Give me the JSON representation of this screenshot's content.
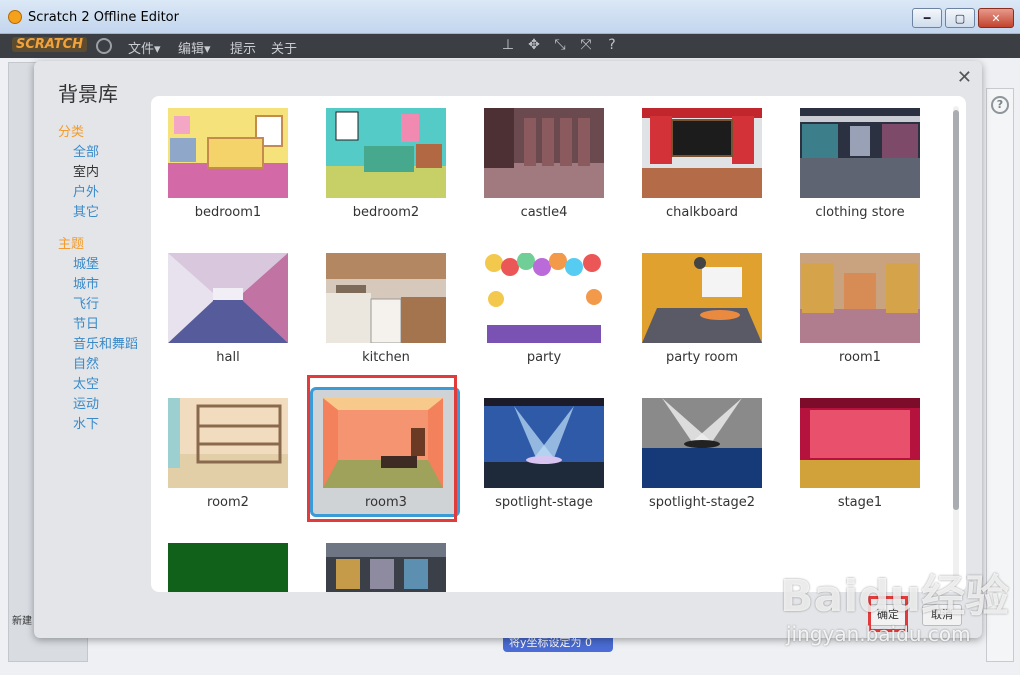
{
  "window": {
    "title": "Scratch 2 Offline Editor"
  },
  "menubar": {
    "logo": "SCRATCH",
    "items": [
      "文件▾",
      "编辑▾",
      "提示",
      "关于"
    ]
  },
  "dialog": {
    "title": "背景库",
    "categories": {
      "heading": "分类",
      "items": [
        {
          "label": "全部",
          "selected": false
        },
        {
          "label": "室内",
          "selected": true
        },
        {
          "label": "户外",
          "selected": false
        },
        {
          "label": "其它",
          "selected": false
        }
      ]
    },
    "themes": {
      "heading": "主题",
      "items": [
        "城堡",
        "城市",
        "飞行",
        "节日",
        "音乐和舞蹈",
        "自然",
        "太空",
        "运动",
        "水下"
      ]
    },
    "backdrops": [
      {
        "name": "bedroom1",
        "selected": false
      },
      {
        "name": "bedroom2",
        "selected": false
      },
      {
        "name": "castle4",
        "selected": false
      },
      {
        "name": "chalkboard",
        "selected": false
      },
      {
        "name": "clothing store",
        "selected": false
      },
      {
        "name": "hall",
        "selected": false
      },
      {
        "name": "kitchen",
        "selected": false
      },
      {
        "name": "party",
        "selected": false
      },
      {
        "name": "party room",
        "selected": false
      },
      {
        "name": "room1",
        "selected": false
      },
      {
        "name": "room2",
        "selected": false
      },
      {
        "name": "room3",
        "selected": true
      },
      {
        "name": "spotlight-stage",
        "selected": false
      },
      {
        "name": "spotlight-stage2",
        "selected": false
      },
      {
        "name": "stage1",
        "selected": false
      },
      {
        "name": "",
        "selected": false
      },
      {
        "name": "",
        "selected": false
      }
    ],
    "ok_label": "确定",
    "cancel_label": "取消"
  },
  "background": {
    "new_label": "新建",
    "block_label": "将y坐标设定为 0"
  },
  "watermark": {
    "brand": "Baidu经验",
    "url": "jingyan.baidu.com"
  }
}
